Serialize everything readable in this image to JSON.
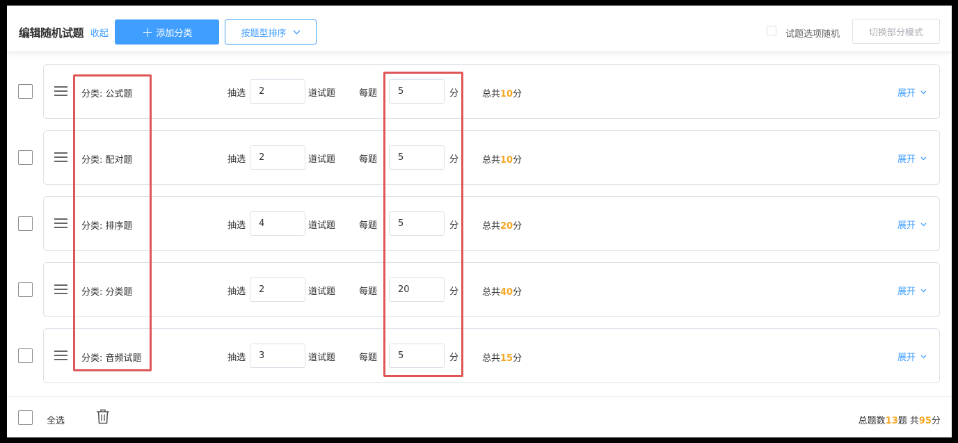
{
  "header": {
    "title": "编辑随机试题",
    "collapse": "收起",
    "add_category": "添加分类",
    "sort_by_type": "按题型排序",
    "random_options_label": "试题选项随机",
    "switch_mode": "切换部分模式"
  },
  "labels": {
    "draw": "抽选",
    "questions_unit": "道试题",
    "per_question": "每题",
    "points_unit": "分",
    "total_prefix": "总共",
    "total_suffix": "分",
    "expand": "展开"
  },
  "rows": [
    {
      "category": "分类: 公式题",
      "count": "2",
      "score": "5",
      "total": "10"
    },
    {
      "category": "分类: 配对题",
      "count": "2",
      "score": "5",
      "total": "10"
    },
    {
      "category": "分类: 排序题",
      "count": "4",
      "score": "5",
      "total": "20"
    },
    {
      "category": "分类: 分类题",
      "count": "2",
      "score": "20",
      "total": "40"
    },
    {
      "category": "分类: 音频试题",
      "count": "3",
      "score": "5",
      "total": "15"
    }
  ],
  "footer": {
    "select_all": "全选",
    "summary_prefix": "总题数",
    "total_questions": "13",
    "summary_mid": "题 共",
    "total_points": "95",
    "summary_suffix": "分"
  },
  "colors": {
    "primary": "#409eff",
    "highlight_orange": "#f5a623",
    "annotation_red": "#e05555"
  },
  "icons": [
    "plus-icon",
    "chevron-down-icon",
    "drag-handle-icon",
    "trash-icon"
  ]
}
